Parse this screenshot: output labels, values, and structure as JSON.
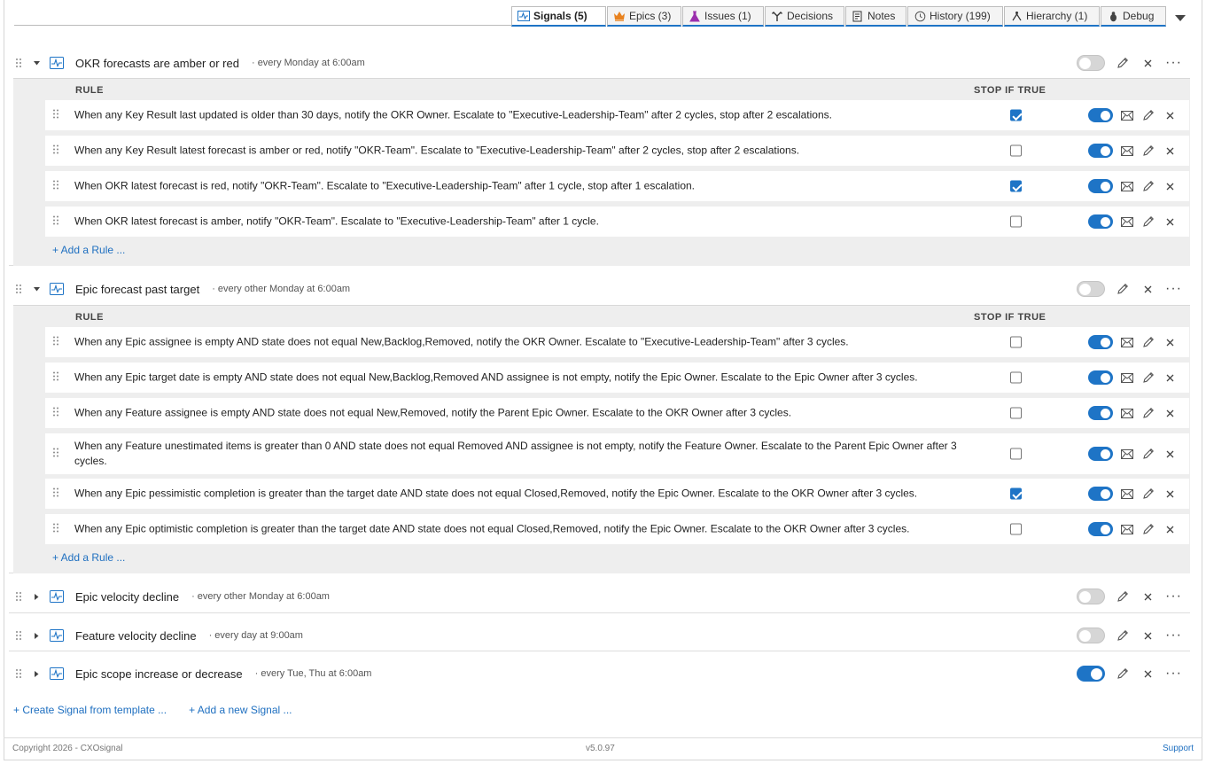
{
  "tabs": [
    {
      "label": "Signals (5)",
      "icon": "signal-icon",
      "active": true
    },
    {
      "label": "Epics (3)",
      "icon": "crown-icon"
    },
    {
      "label": "Issues (1)",
      "icon": "flask-icon"
    },
    {
      "label": "Decisions",
      "icon": "decision-icon"
    },
    {
      "label": "Notes",
      "icon": "note-icon"
    },
    {
      "label": "History (199)",
      "icon": "history-icon"
    },
    {
      "label": "Hierarchy (1)",
      "icon": "hierarchy-icon"
    },
    {
      "label": "Debug",
      "icon": "bug-icon"
    }
  ],
  "headers": {
    "rule": "RULE",
    "stop": "STOP IF TRUE"
  },
  "add_rule_label": "+ Add a Rule ...",
  "signals": [
    {
      "title": "OKR forecasts are amber or red",
      "schedule": "· every Monday at 6:00am",
      "enabled": false,
      "expanded": true,
      "rules": [
        {
          "text": "When any Key Result last updated is older than 30 days, notify the OKR Owner. Escalate to \"Executive-Leadership-Team\" after 2 cycles, stop after 2 escalations.",
          "stop": true,
          "enabled": true
        },
        {
          "text": "When any Key Result latest forecast is amber or red, notify \"OKR-Team\". Escalate to \"Executive-Leadership-Team\" after 2 cycles, stop after 2 escalations.",
          "stop": false,
          "enabled": true
        },
        {
          "text": "When OKR latest forecast is red, notify \"OKR-Team\". Escalate to \"Executive-Leadership-Team\" after 1 cycle, stop after 1 escalation.",
          "stop": true,
          "enabled": true
        },
        {
          "text": "When OKR latest forecast is amber, notify \"OKR-Team\". Escalate to \"Executive-Leadership-Team\" after 1 cycle.",
          "stop": false,
          "enabled": true
        }
      ]
    },
    {
      "title": "Epic forecast past target",
      "schedule": "· every other Monday at 6:00am",
      "enabled": false,
      "expanded": true,
      "rules": [
        {
          "text": "When any Epic assignee is empty AND state does not equal New,Backlog,Removed, notify the OKR Owner. Escalate to \"Executive-Leadership-Team\" after 3 cycles.",
          "stop": false,
          "enabled": true
        },
        {
          "text": "When any Epic target date is empty AND state does not equal New,Backlog,Removed AND assignee is not empty, notify the Epic Owner. Escalate to the Epic Owner after 3 cycles.",
          "stop": false,
          "enabled": true
        },
        {
          "text": "When any Feature assignee is empty AND state does not equal New,Removed, notify the Parent Epic Owner. Escalate to the OKR Owner after 3 cycles.",
          "stop": false,
          "enabled": true
        },
        {
          "text": "When any Feature unestimated items is greater than 0 AND state does not equal Removed AND assignee is not empty, notify the Feature Owner. Escalate to the Parent Epic Owner after 3 cycles.",
          "stop": false,
          "enabled": true
        },
        {
          "text": "When any Epic pessimistic completion is greater than the target date AND state does not equal Closed,Removed, notify the Epic Owner. Escalate to the OKR Owner after 3 cycles.",
          "stop": true,
          "enabled": true
        },
        {
          "text": "When any Epic optimistic completion is greater than the target date AND state does not equal Closed,Removed, notify the Epic Owner. Escalate to the OKR Owner after 3 cycles.",
          "stop": false,
          "enabled": true
        }
      ]
    },
    {
      "title": "Epic velocity decline",
      "schedule": "· every other Monday at 6:00am",
      "enabled": false,
      "expanded": false
    },
    {
      "title": "Feature velocity decline",
      "schedule": "· every day at 9:00am",
      "enabled": false,
      "expanded": false
    },
    {
      "title": "Epic scope increase or decrease",
      "schedule": "· every Tue, Thu at 6:00am",
      "enabled": true,
      "expanded": false
    }
  ],
  "footer_links": {
    "template": "+ Create Signal from template ...",
    "new": "+ Add a new Signal ..."
  },
  "footer": {
    "copyright": "Copyright 2026 - CXOsignal",
    "version": "v5.0.97",
    "support": "Support"
  },
  "colors": {
    "accent": "#1e74c6",
    "link": "#1e6fc0"
  }
}
